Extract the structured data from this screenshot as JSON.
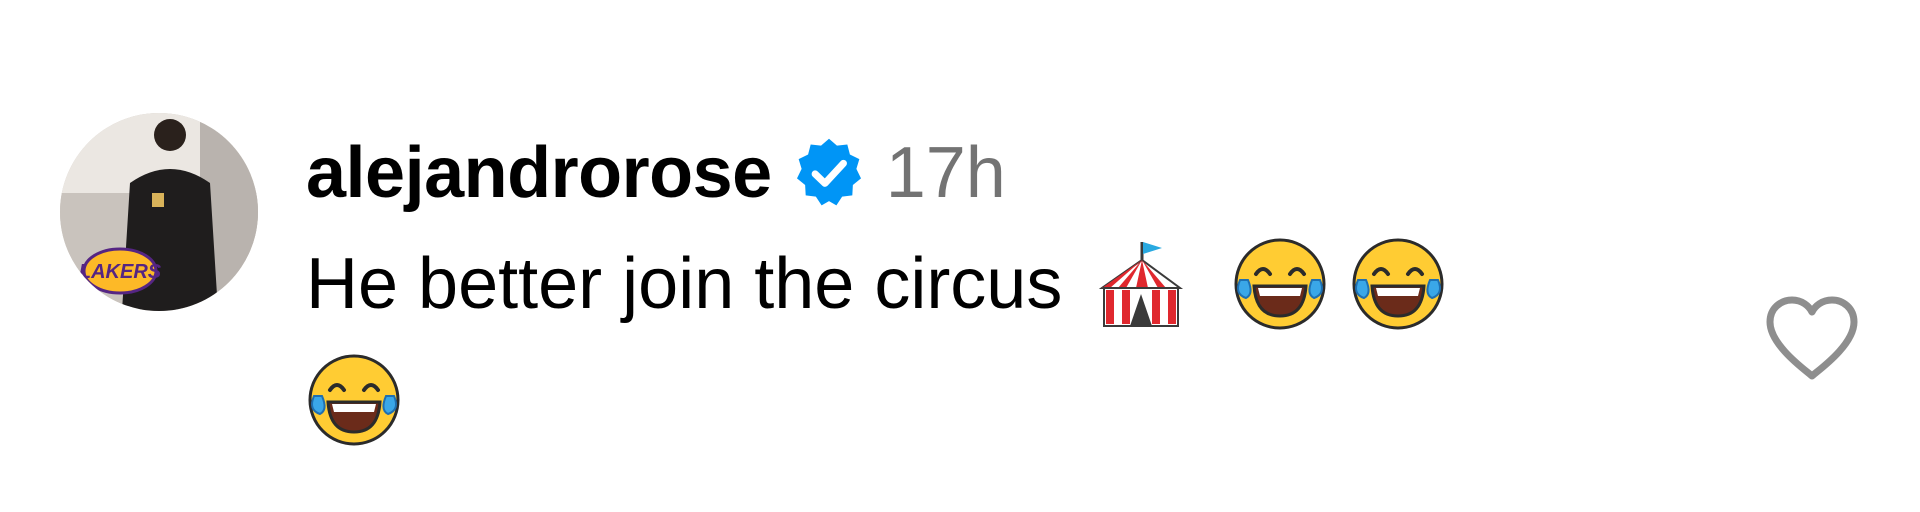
{
  "comment": {
    "username": "alejandrorose",
    "timestamp": "17h",
    "text": "He better join the circus",
    "emojis": [
      "circus-tent",
      "face-with-tears-of-joy",
      "face-with-tears-of-joy",
      "face-with-tears-of-joy"
    ],
    "verified": true,
    "avatar_badge_text": "LAKERS"
  },
  "colors": {
    "verified_blue": "#0095f6",
    "timestamp_gray": "#737373",
    "heart_outline": "#8e8e8e",
    "lakers_purple": "#552583",
    "lakers_gold": "#fdb927"
  },
  "icons": {
    "like": "heart-outline-icon",
    "verified": "verified-badge-icon"
  }
}
